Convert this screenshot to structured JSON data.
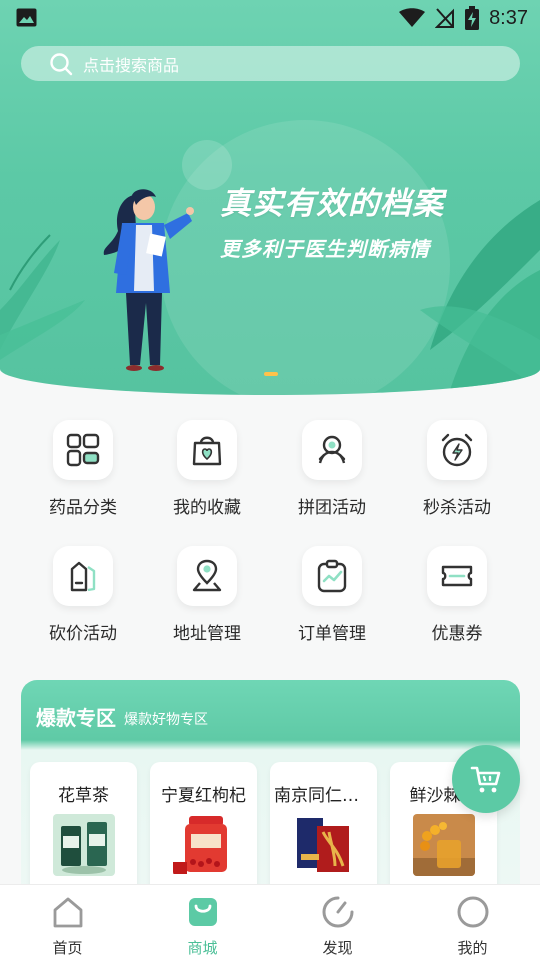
{
  "status_bar": {
    "time": "8:37",
    "icons": [
      "image-icon",
      "wifi-icon",
      "no-signal-icon",
      "battery-charging-icon"
    ]
  },
  "search": {
    "placeholder": "点击搜索商品"
  },
  "banner": {
    "title": "真实有效的档案",
    "subtitle": "更多利于医生判断病情",
    "page_indicator_count": 1
  },
  "menu": {
    "items": [
      {
        "label": "药品分类",
        "icon": "category-grid-icon"
      },
      {
        "label": "我的收藏",
        "icon": "favorite-bag-icon"
      },
      {
        "label": "拼团活动",
        "icon": "group-buy-icon"
      },
      {
        "label": "秒杀活动",
        "icon": "flash-sale-clock-icon"
      },
      {
        "label": "砍价活动",
        "icon": "bargain-tag-icon"
      },
      {
        "label": "地址管理",
        "icon": "location-pin-icon"
      },
      {
        "label": "订单管理",
        "icon": "order-clipboard-icon"
      },
      {
        "label": "优惠券",
        "icon": "coupon-ticket-icon"
      }
    ]
  },
  "hot_zone": {
    "title": "爆款专区",
    "subtitle": "爆款好物专区",
    "products": [
      {
        "name": "花草茶"
      },
      {
        "name": "宁夏红枸杞"
      },
      {
        "name": "南京同仁堂..."
      },
      {
        "name": "鲜沙棘原"
      }
    ]
  },
  "cart_fab": {
    "icon": "cart-icon"
  },
  "tabbar": {
    "tabs": [
      {
        "label": "首页",
        "icon": "home-icon",
        "active": false
      },
      {
        "label": "商城",
        "icon": "shop-bag-icon",
        "active": true
      },
      {
        "label": "发现",
        "icon": "discover-icon",
        "active": false
      },
      {
        "label": "我的",
        "icon": "profile-icon",
        "active": false
      }
    ]
  },
  "colors": {
    "brand_green": "#5cc9a6",
    "active_tab": "#4bbf97",
    "indicator": "#ffc24a"
  }
}
